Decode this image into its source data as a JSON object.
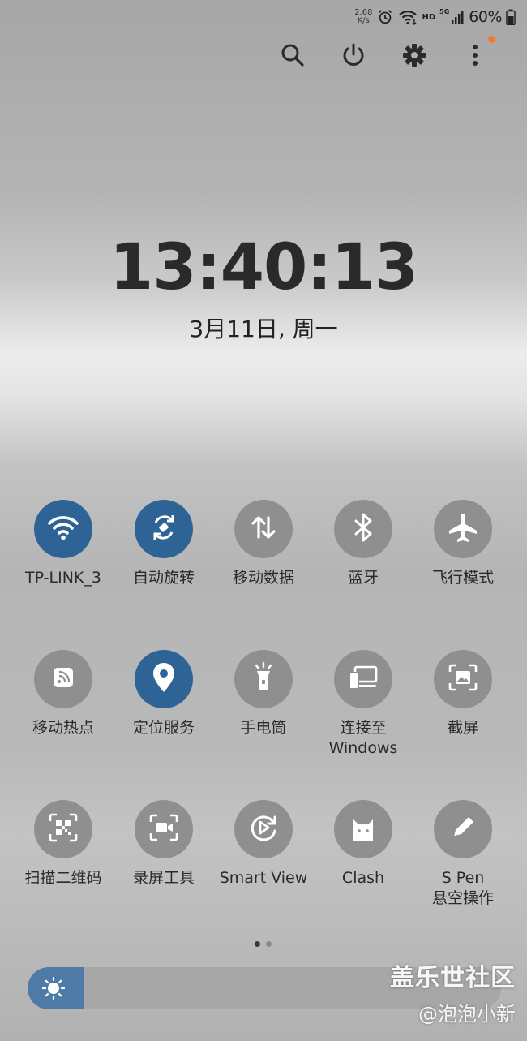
{
  "status_bar": {
    "speed_value": "2.68",
    "speed_unit": "K/s",
    "network_hd": "HD",
    "network_gen": "5G",
    "battery": "60%"
  },
  "top_actions": [
    {
      "name": "search-icon"
    },
    {
      "name": "power-icon"
    },
    {
      "name": "gear-icon"
    },
    {
      "name": "more-vertical-icon"
    }
  ],
  "clock": {
    "time": "13:40:13",
    "date": "3月11日, 周一"
  },
  "tiles": [
    {
      "label": "TP-LINK_3",
      "icon": "wifi-icon",
      "active": true
    },
    {
      "label": "自动旋转",
      "icon": "auto-rotate-icon",
      "active": true
    },
    {
      "label": "移动数据",
      "icon": "mobile-data-icon",
      "active": false
    },
    {
      "label": "蓝牙",
      "icon": "bluetooth-icon",
      "active": false
    },
    {
      "label": "飞行模式",
      "icon": "airplane-icon",
      "active": false
    },
    {
      "label": "移动热点",
      "icon": "hotspot-icon",
      "active": false
    },
    {
      "label": "定位服务",
      "icon": "location-icon",
      "active": true
    },
    {
      "label": "手电筒",
      "icon": "flashlight-icon",
      "active": false
    },
    {
      "label": "连接至",
      "label2": "Windows",
      "icon": "link-to-windows-icon",
      "active": false
    },
    {
      "label": "截屏",
      "icon": "screenshot-icon",
      "active": false
    },
    {
      "label": "扫描二维码",
      "icon": "qr-scan-icon",
      "active": false
    },
    {
      "label": "录屏工具",
      "icon": "screen-record-icon",
      "active": false
    },
    {
      "label": "Smart View",
      "icon": "smart-view-icon",
      "active": false
    },
    {
      "label": "Clash",
      "icon": "clash-cat-icon",
      "active": false
    },
    {
      "label": "S Pen",
      "label2": "悬空操作",
      "icon": "pen-icon",
      "active": false
    }
  ],
  "pager": {
    "pages": 2,
    "current": 1
  },
  "brightness": {
    "level": 0.12
  },
  "watermark": {
    "line1": "盖乐世社区",
    "line2": "@泡泡小新"
  },
  "colors": {
    "active_tile": "#2e6396",
    "inactive_tile": "#8f8f8f",
    "brightness_fill": "#4d7aa6",
    "notification_dot": "#f07a2c"
  }
}
